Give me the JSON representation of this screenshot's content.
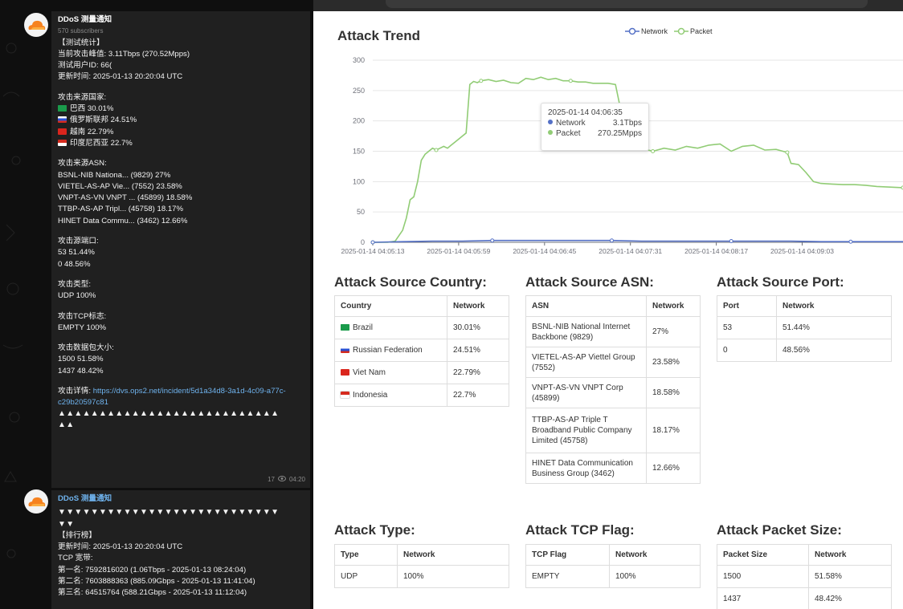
{
  "telegram": {
    "channel_name": "DDoS 测量通知",
    "subscribers": "570 subscribers",
    "message1": {
      "lines": [
        "【测试统计】",
        "当前攻击峰值: 3.11Tbps (270.52Mpps)",
        "测试用户ID: 66(",
        "更新时间: 2025-01-13 20:20:04 UTC",
        "",
        "攻击来源国家:",
        "巴西 30.01%",
        "俄罗斯联邦 24.51%",
        "越南 22.79%",
        "印度尼西亚 22.7%",
        "",
        "攻击来源ASN:",
        "BSNL-NIB Nationa... (9829) 27%",
        "VIETEL-AS-AP Vie... (7552) 23.58%",
        "VNPT-AS-VN VNPT ... (45899) 18.58%",
        "TTBP-AS-AP Tripl... (45758) 18.17%",
        "HINET Data Commu... (3462) 12.66%",
        "",
        "攻击源端口:",
        "53 51.44%",
        "0 48.56%",
        "",
        "攻击类型:",
        "UDP 100%",
        "",
        "攻击TCP标志:",
        "EMPTY 100%",
        "",
        "攻击数据包大小:",
        "1500 51.58%",
        "1437 48.42%"
      ],
      "detail_prefix": "攻击详情: ",
      "detail_link": "https://dvs.ops2.net/incident/5d1a34d8-3a1d-4c09-a77c-c29b20597c81",
      "triangles_line1": "▲▲▲▲▲▲▲▲▲▲▲▲▲▲▲▲▲▲▲▲▲▲▲▲▲▲▲",
      "triangles_line2": "▲▲",
      "views": "17",
      "time": "04:20"
    },
    "message2": {
      "channel_name": "DDoS 测量通知",
      "triangles_line1": "▼▼▼▼▼▼▼▼▼▼▼▼▼▼▼▼▼▼▼▼▼▼▼▼▼▼▼",
      "triangles_line2": "▼▼",
      "lines": [
        "【排行榜】",
        "更新时间: 2025-01-13 20:20:04 UTC",
        "TCP 宽带:",
        "第一名: 7592816020 (1.06Tbps - 2025-01-13 08:24:04)",
        "第二名: 7603888363 (885.09Gbps - 2025-01-13 11:41:04)",
        "第三名: 64515764 (588.21Gbps - 2025-01-13 11:12:04)"
      ]
    }
  },
  "web": {
    "trend_title": "Attack Trend",
    "legend": [
      "Network",
      "Packet"
    ],
    "colors": {
      "network": "#5470c6",
      "packet": "#91cc75"
    },
    "tooltip": {
      "time": "2025-01-14 04:06:35",
      "network_label": "Network",
      "network_value": "3.1Tbps",
      "packet_label": "Packet",
      "packet_value": "270.25Mpps"
    },
    "sections": {
      "country_title": "Attack Source Country:",
      "asn_title": "Attack Source ASN:",
      "port_title": "Attack Source Port:",
      "type_title": "Attack Type:",
      "tcpflag_title": "Attack TCP Flag:",
      "size_title": "Attack Packet Size:"
    },
    "country_table": {
      "headers": [
        "Country",
        "Network"
      ],
      "rows": [
        {
          "flag": "br",
          "name": "Brazil",
          "value": "30.01%"
        },
        {
          "flag": "ru",
          "name": "Russian Federation",
          "value": "24.51%"
        },
        {
          "flag": "vn",
          "name": "Viet Nam",
          "value": "22.79%"
        },
        {
          "flag": "id",
          "name": "Indonesia",
          "value": "22.7%"
        }
      ]
    },
    "asn_table": {
      "headers": [
        "ASN",
        "Network"
      ],
      "rows": [
        {
          "name": "BSNL-NIB National Internet Backbone (9829)",
          "value": "27%"
        },
        {
          "name": "VIETEL-AS-AP Viettel Group (7552)",
          "value": "23.58%"
        },
        {
          "name": "VNPT-AS-VN VNPT Corp (45899)",
          "value": "18.58%"
        },
        {
          "name": "TTBP-AS-AP Triple T Broadband Public Company Limited (45758)",
          "value": "18.17%"
        },
        {
          "name": "HINET Data Communication Business Group (3462)",
          "value": "12.66%"
        }
      ]
    },
    "port_table": {
      "headers": [
        "Port",
        "Network"
      ],
      "rows": [
        {
          "name": "53",
          "value": "51.44%"
        },
        {
          "name": "0",
          "value": "48.56%"
        }
      ]
    },
    "type_table": {
      "headers": [
        "Type",
        "Network"
      ],
      "rows": [
        {
          "name": "UDP",
          "value": "100%"
        }
      ]
    },
    "tcpflag_table": {
      "headers": [
        "TCP Flag",
        "Network"
      ],
      "rows": [
        {
          "name": "EMPTY",
          "value": "100%"
        }
      ]
    },
    "size_table": {
      "headers": [
        "Packet Size",
        "Network"
      ],
      "rows": [
        {
          "name": "1500",
          "value": "51.58%"
        },
        {
          "name": "1437",
          "value": "48.42%"
        }
      ]
    }
  },
  "chart_data": {
    "type": "line",
    "title": "Attack Trend",
    "ylim": [
      0,
      300
    ],
    "yticks": [
      0,
      50,
      100,
      150,
      200,
      250,
      300
    ],
    "xlim_seconds": [
      0,
      284
    ],
    "x_tick_labels": [
      "2025-01-14 04:05:13",
      "2025-01-14 04:05:59",
      "2025-01-14 04:06:45",
      "2025-01-14 04:07:31",
      "2025-01-14 04:08:17",
      "2025-01-14 04:09:03"
    ],
    "x_tick_seconds": [
      0,
      46,
      92,
      138,
      184,
      230
    ],
    "series": [
      {
        "name": "Packet",
        "x_seconds": [
          0,
          8,
          12,
          16,
          18,
          20,
          22,
          24,
          26,
          28,
          30,
          32,
          34,
          36,
          38,
          40,
          42,
          44,
          46,
          48,
          50,
          52,
          54,
          56,
          58,
          62,
          66,
          70,
          74,
          78,
          82,
          86,
          90,
          94,
          98,
          102,
          106,
          110,
          114,
          118,
          122,
          126,
          130,
          132,
          134,
          136,
          140,
          144,
          150,
          156,
          162,
          168,
          174,
          180,
          186,
          192,
          198,
          204,
          210,
          216,
          222,
          224,
          228,
          232,
          236,
          240,
          246,
          252,
          258,
          264,
          270,
          276,
          284
        ],
        "values": [
          0,
          0,
          2,
          20,
          40,
          70,
          75,
          100,
          135,
          145,
          150,
          155,
          152,
          155,
          158,
          155,
          160,
          165,
          170,
          175,
          180,
          260,
          265,
          263,
          266,
          268,
          265,
          267,
          263,
          262,
          270,
          268,
          272,
          268,
          270,
          266,
          266,
          264,
          264,
          262,
          262,
          262,
          260,
          230,
          175,
          160,
          152,
          155,
          150,
          155,
          152,
          158,
          155,
          160,
          162,
          150,
          158,
          160,
          152,
          153,
          148,
          130,
          128,
          115,
          100,
          97,
          96,
          95,
          95,
          94,
          92,
          91,
          90
        ]
      },
      {
        "name": "Network",
        "x_seconds": [
          0,
          16,
          32,
          48,
          64,
          80,
          96,
          112,
          128,
          144,
          160,
          176,
          192,
          208,
          224,
          240,
          256,
          284
        ],
        "values": [
          0,
          1,
          2,
          2,
          3,
          3,
          3,
          3,
          3,
          2,
          2,
          2,
          2,
          2,
          2,
          1,
          1,
          1
        ]
      }
    ]
  }
}
